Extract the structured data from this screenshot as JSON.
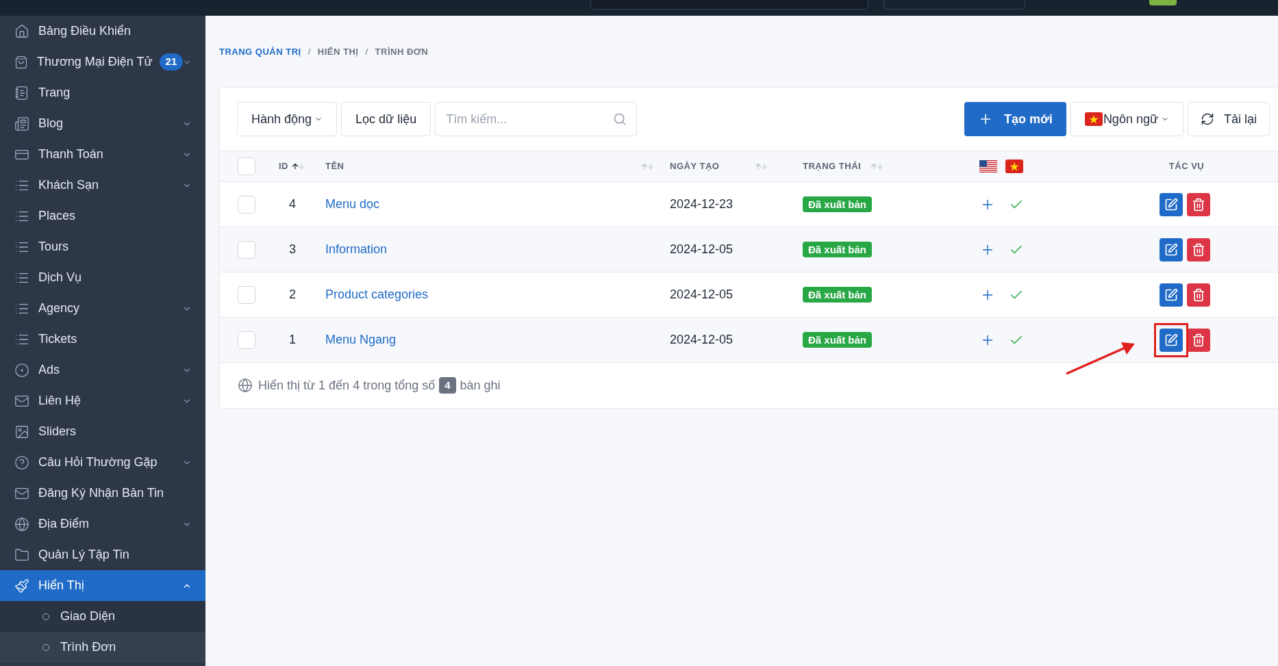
{
  "sidebar": {
    "items": [
      {
        "label": "Bảng Điều Khiển",
        "selected": false
      },
      {
        "label": "Thương Mại Điện Tử",
        "badge": "21",
        "expanded": false,
        "selected": false
      },
      {
        "label": "Trang",
        "selected": false
      },
      {
        "label": "Blog",
        "expanded": false,
        "selected": false
      },
      {
        "label": "Thanh Toán",
        "expanded": false,
        "selected": false
      },
      {
        "label": "Khách Sạn",
        "expanded": false,
        "selected": false
      },
      {
        "label": "Places",
        "selected": false
      },
      {
        "label": "Tours",
        "selected": false
      },
      {
        "label": "Dịch Vụ",
        "selected": false
      },
      {
        "label": "Agency",
        "expanded": false,
        "selected": false
      },
      {
        "label": "Tickets",
        "selected": false
      },
      {
        "label": "Ads",
        "expanded": false,
        "selected": false
      },
      {
        "label": "Liên Hệ",
        "expanded": false,
        "selected": false
      },
      {
        "label": "Sliders",
        "selected": false
      },
      {
        "label": "Câu Hỏi Thường Gặp",
        "expanded": false,
        "selected": false
      },
      {
        "label": "Đăng Ký Nhận Bản Tin",
        "selected": false
      },
      {
        "label": "Địa Điểm",
        "expanded": false,
        "selected": false
      },
      {
        "label": "Quản Lý Tập Tin",
        "selected": false
      },
      {
        "label": "Hiển Thị",
        "expanded": true,
        "selected": true,
        "children": [
          {
            "label": "Giao Diện",
            "selected": false
          },
          {
            "label": "Trình Đơn",
            "selected": true
          }
        ]
      }
    ]
  },
  "breadcrumb": {
    "separator": "/",
    "items": [
      "TRANG QUẢN TRỊ",
      "HIỂN THỊ",
      "TRÌNH ĐƠN"
    ]
  },
  "toolbar": {
    "actions": "Hành động",
    "filter": "Lọc dữ liệu",
    "search": {
      "placeholder": "Tìm kiếm..."
    },
    "create": "Tạo mới",
    "language": "Ngôn ngữ",
    "reload": "Tải lại"
  },
  "table": {
    "columns": [
      {
        "kind": "check",
        "checked": false
      },
      {
        "kind": "text",
        "label": "ID",
        "sorted": true
      },
      {
        "kind": "text",
        "label": "TÊN",
        "sorted": false
      },
      {
        "kind": "text",
        "label": "NGÀY TẠO",
        "sorted": false
      },
      {
        "kind": "text",
        "label": "TRẠNG THÁI",
        "sorted": false
      },
      {
        "kind": "languages"
      },
      {
        "kind": "text",
        "label": "TÁC VỤ"
      }
    ],
    "rows": [
      {
        "checked": false,
        "id": "4",
        "name": "Menu dọc",
        "date": "2024-12-23",
        "status": "Đã xuất bản",
        "translations": [
          {
            "kind": "add"
          },
          {
            "kind": "done"
          }
        ],
        "highlighted": false
      },
      {
        "checked": false,
        "id": "3",
        "name": "Information",
        "date": "2024-12-05",
        "status": "Đã xuất bản",
        "translations": [
          {
            "kind": "add"
          },
          {
            "kind": "done"
          }
        ],
        "highlighted": false
      },
      {
        "checked": false,
        "id": "2",
        "name": "Product categories",
        "date": "2024-12-05",
        "status": "Đã xuất bản",
        "translations": [
          {
            "kind": "add"
          },
          {
            "kind": "done"
          }
        ],
        "highlighted": false
      },
      {
        "checked": false,
        "id": "1",
        "name": "Menu Ngang",
        "date": "2024-12-05",
        "status": "Đã xuất bản",
        "translations": [
          {
            "kind": "add"
          },
          {
            "kind": "done"
          }
        ],
        "highlighted": true
      }
    ],
    "footer": {
      "before": "Hiển thị từ 1 đến 4 trong tổng số",
      "count": "4",
      "after": "bàn ghi"
    }
  }
}
